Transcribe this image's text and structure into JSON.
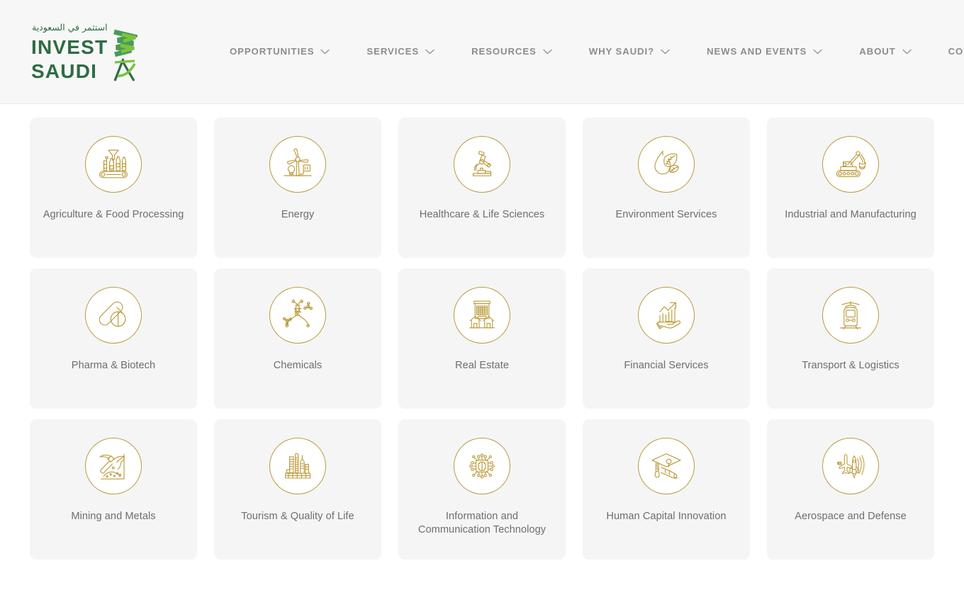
{
  "brand": {
    "arabic_tagline": "استثمر في السعودية",
    "line1": "INVEST",
    "line2": "SAUDI",
    "colors": {
      "dark_green": "#2f6b43",
      "mid_green": "#4a9a56",
      "light_green": "#7cc242"
    }
  },
  "nav": {
    "items": [
      {
        "label": "OPPORTUNITIES",
        "caret": "chevron-down-icon"
      },
      {
        "label": "SERVICES",
        "caret": "chevron-down-icon"
      },
      {
        "label": "RESOURCES",
        "caret": "chevron-down-icon"
      },
      {
        "label": "WHY SAUDI?",
        "caret": "chevron-down-icon"
      },
      {
        "label": "NEWS AND EVENTS",
        "caret": "chevron-down-icon"
      },
      {
        "label": "ABOUT",
        "caret": "chevron-down-icon"
      },
      {
        "label": "CONTACT",
        "caret": "chevron-down-icon"
      }
    ],
    "text_color": "#8c8c8c"
  },
  "theme": {
    "page_background": "#ffffff",
    "header_background": "#f7f7f7",
    "card_background": "#f5f5f5",
    "icon_gold": "#bb9b3c",
    "label_color": "#6e6e6e"
  },
  "sectors": [
    {
      "label": "Agriculture & Food Processing",
      "icon": "bottling-line-icon"
    },
    {
      "label": "Energy",
      "icon": "wind-turbine-icon"
    },
    {
      "label": "Healthcare & Life Sciences",
      "icon": "microscope-icon"
    },
    {
      "label": "Environment Services",
      "icon": "water-drop-leaf-icon"
    },
    {
      "label": "Industrial and Manufacturing",
      "icon": "excavator-icon"
    },
    {
      "label": "Pharma & Biotech",
      "icon": "pills-capsule-icon"
    },
    {
      "label": "Chemicals",
      "icon": "dna-molecule-icon"
    },
    {
      "label": "Real Estate",
      "icon": "buildings-icon"
    },
    {
      "label": "Financial Services",
      "icon": "hand-growth-chart-icon"
    },
    {
      "label": "Transport & Logistics",
      "icon": "train-icon"
    },
    {
      "label": "Mining and Metals",
      "icon": "pickaxe-icon"
    },
    {
      "label": "Tourism & Quality of Life",
      "icon": "city-skyline-icon"
    },
    {
      "label": "Information and Communication Technology",
      "icon": "chip-brain-icon"
    },
    {
      "label": "Human Capital Innovation",
      "icon": "graduation-cap-icon"
    },
    {
      "label": "Aerospace and Defense",
      "icon": "jet-rocket-radar-icon"
    }
  ]
}
